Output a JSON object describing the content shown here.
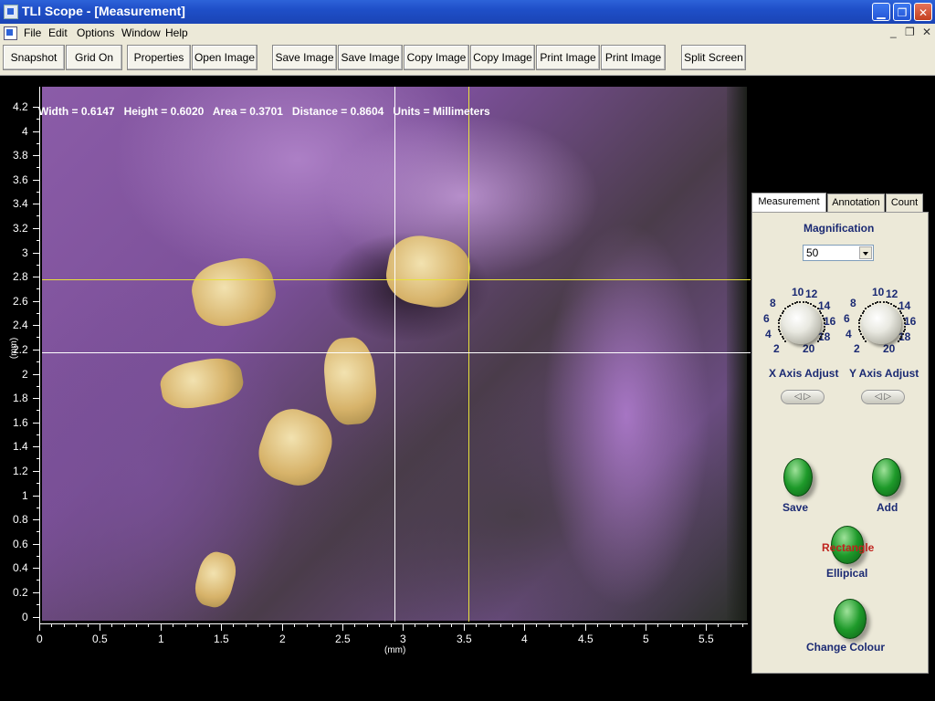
{
  "window": {
    "title": "TLI Scope - [Measurement]"
  },
  "menu": [
    "File",
    "Edit",
    "Options",
    "Window",
    "Help"
  ],
  "toolbar": [
    "Snapshot",
    "Grid On",
    "Properties",
    "Open Image",
    "Save Image",
    "Save Image",
    "Copy Image",
    "Copy Image",
    "Print Image",
    "Print Image",
    "Split Screen"
  ],
  "readout": "Width = 0.6147   Height = 0.6020   Area = 0.3701   Distance = 0.8604   Units = Millimeters",
  "axes": {
    "y_ticks": [
      "4.2",
      "4",
      "3.8",
      "3.6",
      "3.4",
      "3.2",
      "3",
      "2.8",
      "2.6",
      "2.4",
      "2.2",
      "2",
      "1.8",
      "1.6",
      "1.4",
      "1.2",
      "1",
      "0.8",
      "0.6",
      "0.4",
      "0.2",
      "0"
    ],
    "x_ticks": [
      "0",
      "0.5",
      "1",
      "1.5",
      "2",
      "2.5",
      "3",
      "3.5",
      "4",
      "4.5",
      "5",
      "5.5"
    ],
    "y_unit": "(mm)",
    "x_unit": "(mm)"
  },
  "cursors": {
    "yellow_color": "#e8e23a",
    "white_color": "#ffffff"
  },
  "tabs": [
    "Measurement",
    "Annotation",
    "Count"
  ],
  "panel": {
    "magnification_label": "Magnification",
    "magnification_value": "50",
    "dial_numbers": [
      "10",
      "12",
      "14",
      "16",
      "18",
      "20",
      "2",
      "4",
      "6",
      "8"
    ],
    "x_axis_label": "X Axis Adjust",
    "y_axis_label": "Y Axis Adjust",
    "stepper_glyph": "◁ ▷",
    "save_label": "Save",
    "add_label": "Add",
    "rectangle_label": "Rectangle",
    "ellipical_label": "Ellipical",
    "change_colour_label": "Change Colour"
  }
}
